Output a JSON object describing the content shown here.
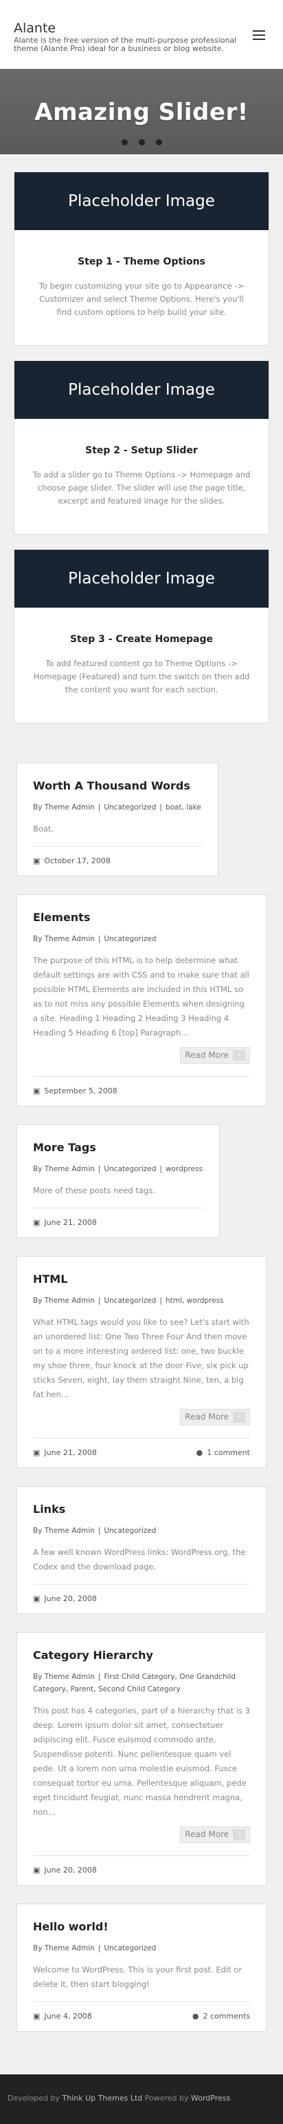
{
  "header": {
    "title": "Alante",
    "description": "Alante is the free version of the multi-purpose professional theme (Alante Pro) ideal for a business or blog website."
  },
  "slider": {
    "title": "Amazing Slider!",
    "dots": 3
  },
  "steps": [
    {
      "image_label": "Placeholder Image",
      "title": "Step 1 - Theme Options",
      "text": "To begin customizing your site go to Appearance -> Customizer and select Theme Options. Here's you'll find custom options to help build your site."
    },
    {
      "image_label": "Placeholder Image",
      "title": "Step 2 - Setup Slider",
      "text": "To add a slider go to Theme Options -> Homepage and choose page slider. The slider will use the page title, excerpt and featured image for the slides."
    },
    {
      "image_label": "Placeholder Image",
      "title": "Step 3 - Create Homepage",
      "text": "To add featured content go to Theme Options -> Homepage (Featured) and turn the switch on then add the content you want for each section."
    }
  ],
  "posts": [
    {
      "title": "Worth A Thousand Words",
      "author": "By Theme Admin",
      "category": "Uncategorized",
      "tags": "boat, lake",
      "excerpt": "Boat.",
      "date": "October 17, 2008",
      "read_more": "",
      "comments": ""
    },
    {
      "title": "Elements",
      "author": "By Theme Admin",
      "category": "Uncategorized",
      "tags": "",
      "excerpt": "The purpose of this HTML is to help determine what default settings are with CSS and to make sure that all possible HTML Elements are included in this HTML so as to not miss any possible Elements when designing a site. Heading 1 Heading 2 Heading 3 Heading 4 Heading 5 Heading 6 [top] Paragraph…",
      "date": "September 5, 2008",
      "read_more": "Read More",
      "comments": ""
    },
    {
      "title": "More Tags",
      "author": "By Theme Admin",
      "category": "Uncategorized",
      "tags": "wordpress",
      "excerpt": "More of these posts need tags.",
      "date": "June 21, 2008",
      "read_more": "",
      "comments": ""
    },
    {
      "title": "HTML",
      "author": "By Theme Admin",
      "category": "Uncategorized",
      "tags": "html, wordpress",
      "excerpt": "What HTML tags would you like to see? Let's start with an unordered list: One Two Three Four And then move on to a more interesting ordered list: one, two buckle my shoe three, four knock at the door Five, six pick up sticks Seven, eight, lay them straight Nine, ten, a big fat hen…",
      "date": "June 21, 2008",
      "read_more": "Read More",
      "comments": "1 comment"
    },
    {
      "title": "Links",
      "author": "By Theme Admin",
      "category": "Uncategorized",
      "tags": "",
      "excerpt": "A few well known WordPress links: WordPress.org, the Codex and the download page.",
      "date": "June 20, 2008",
      "read_more": "",
      "comments": ""
    },
    {
      "title": "Category Hierarchy",
      "author": "By Theme Admin",
      "category": "First Child Category, One Grandchild Category, Parent, Second Child Category",
      "tags": "",
      "excerpt": "This post has 4 categories, part of a hierarchy that is 3 deep. Lorem ipsum dolor sit amet, consectetuer adipiscing elit. Fusce euismod commodo ante. Suspendisse potenti. Nunc pellentesque quam vel pede. Ut a lorem non urna molestie euismod. Fusce consequat tortor eu urna. Pellentesque aliquam, pede eget tincidunt feugiat, nunc massa hendrerit magna, non…",
      "date": "June 20, 2008",
      "read_more": "Read More",
      "comments": ""
    },
    {
      "title": "Hello world!",
      "author": "By Theme Admin",
      "category": "Uncategorized",
      "tags": "",
      "excerpt": "Welcome to WordPress. This is your first post. Edit or delete it, then start blogging!",
      "date": "June 4, 2008",
      "read_more": "",
      "comments": "2 comments"
    }
  ],
  "footer": {
    "developed_by": "Developed by",
    "developer": "Think Up Themes Ltd",
    "powered_by": "Powered by",
    "platform": "WordPress"
  },
  "colors": {
    "step_image_bg": "#182431",
    "footer_bg": "#222222"
  }
}
